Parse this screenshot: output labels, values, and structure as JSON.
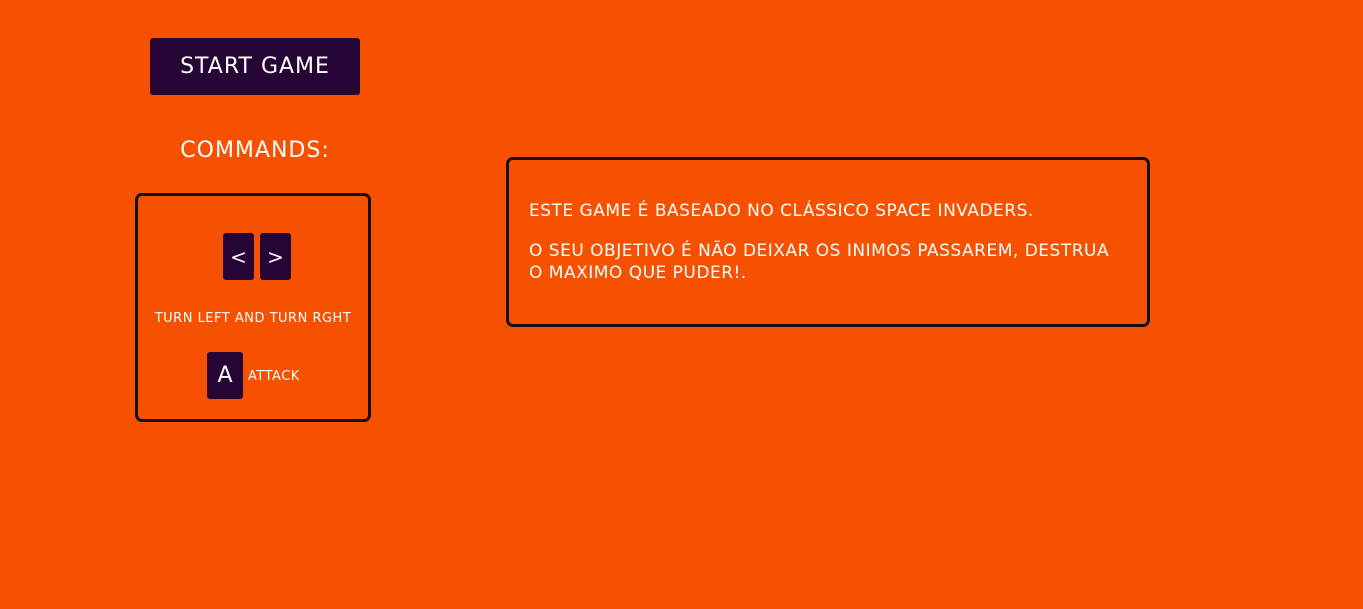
{
  "start_button": {
    "label": "START GAME"
  },
  "commands": {
    "title": "COMMANDS:",
    "keys": {
      "left": "<",
      "right": ">",
      "attack": "A"
    },
    "turn_description": "TURN LEFT AND TURN RGHT",
    "attack_description": "ATTACK"
  },
  "info": {
    "line1": "ESTE GAME É BASEADO NO CLÁSSICO SPACE INVADERS.",
    "line2": "O SEU OBJETIVO É NÃO DEIXAR OS INIMOS PASSAREM, DESTRUA O MAXIMO QUE PUDER!."
  },
  "colors": {
    "background": "#f75100",
    "button": "#260436",
    "border": "#111111",
    "text": "#ffffff"
  }
}
